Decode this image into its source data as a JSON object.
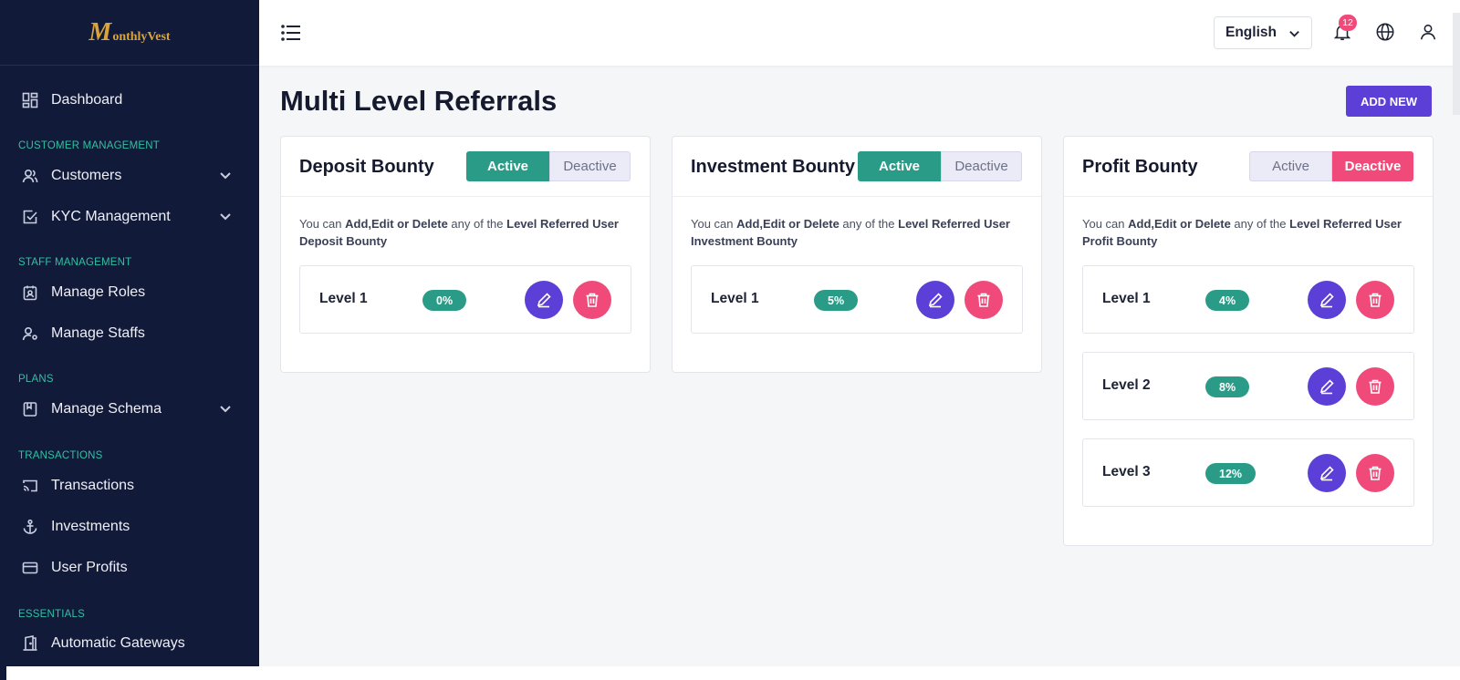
{
  "app": {
    "logo_letter": "M",
    "logo_text": "onthlyVest"
  },
  "sidebar": {
    "items": [
      {
        "label": "Dashboard",
        "icon": "dashboard-icon"
      },
      {
        "section": "CUSTOMER MANAGEMENT"
      },
      {
        "label": "Customers",
        "icon": "users-icon",
        "expandable": true
      },
      {
        "label": "KYC Management",
        "icon": "checkbox-icon",
        "expandable": true
      },
      {
        "section": "STAFF MANAGEMENT"
      },
      {
        "label": "Manage Roles",
        "icon": "badge-icon"
      },
      {
        "label": "Manage Staffs",
        "icon": "user-cog-icon"
      },
      {
        "section": "PLANS"
      },
      {
        "label": "Manage Schema",
        "icon": "schema-icon",
        "expandable": true
      },
      {
        "section": "TRANSACTIONS"
      },
      {
        "label": "Transactions",
        "icon": "cast-icon"
      },
      {
        "label": "Investments",
        "icon": "anchor-icon"
      },
      {
        "label": "User Profits",
        "icon": "credit-card-icon"
      },
      {
        "section": "ESSENTIALS"
      },
      {
        "label": "Automatic Gateways",
        "icon": "door-icon"
      }
    ]
  },
  "topbar": {
    "language": "English",
    "notification_count": "12"
  },
  "page": {
    "title": "Multi Level Referrals",
    "add_new_label": "ADD NEW"
  },
  "cards": [
    {
      "title": "Deposit Bounty",
      "active_label": "Active",
      "deactive_label": "Deactive",
      "status": "active",
      "desc_prefix": "You can ",
      "desc_actions": "Add,Edit or Delete",
      "desc_mid": " any of the ",
      "desc_target": "Level Referred User Deposit Bounty",
      "levels": [
        {
          "name": "Level 1",
          "percent": "0%"
        }
      ]
    },
    {
      "title": "Investment Bounty",
      "active_label": "Active",
      "deactive_label": "Deactive",
      "status": "active",
      "desc_prefix": "You can ",
      "desc_actions": "Add,Edit or Delete",
      "desc_mid": " any of the ",
      "desc_target": "Level Referred User Investment Bounty",
      "levels": [
        {
          "name": "Level 1",
          "percent": "5%"
        }
      ]
    },
    {
      "title": "Profit Bounty",
      "active_label": "Active",
      "deactive_label": "Deactive",
      "status": "deactive",
      "desc_prefix": "You can ",
      "desc_actions": "Add,Edit or Delete",
      "desc_mid": " any of the ",
      "desc_target": "Level Referred User Profit Bounty",
      "levels": [
        {
          "name": "Level 1",
          "percent": "4%"
        },
        {
          "name": "Level 2",
          "percent": "8%"
        },
        {
          "name": "Level 3",
          "percent": "12%"
        }
      ]
    }
  ],
  "colors": {
    "sidebar_bg": "#121a3a",
    "section_label": "#2fc1a3",
    "primary": "#5b3fd6",
    "success": "#2a9b87",
    "danger": "#ef4a7a"
  }
}
